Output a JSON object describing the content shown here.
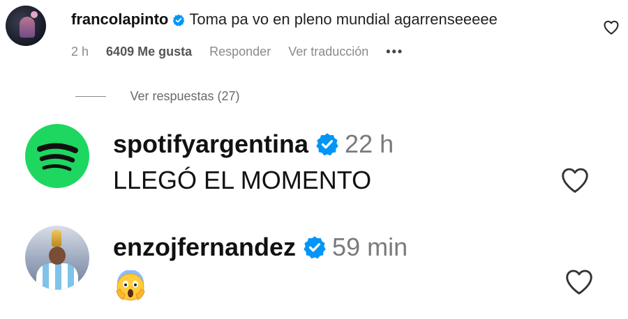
{
  "top_comment": {
    "username": "francolapinto",
    "text": "Toma pa vo en pleno mundial agarrenseeeee",
    "time": "2 h",
    "likes": "6409 Me gusta",
    "reply_label": "Responder",
    "translate_label": "Ver traducción",
    "more_label": "•••",
    "verified": true
  },
  "view_replies": {
    "label": "Ver respuestas (27)"
  },
  "replies": [
    {
      "username": "spotifyargentina",
      "time": "22 h",
      "text": "LLEGÓ EL MOMENTO",
      "verified": true,
      "avatar": "spotify-logo"
    },
    {
      "username": "enzojfernandez",
      "time": "59 min",
      "text": "😱",
      "verified": true,
      "avatar": "player-holding-trophy"
    }
  ],
  "colors": {
    "verified_blue": "#0095f6",
    "spotify_green": "#1ed760",
    "meta_gray": "#8a8a8a"
  },
  "icons": {
    "like": "heart-outline-icon",
    "verified": "verified-badge-icon"
  }
}
